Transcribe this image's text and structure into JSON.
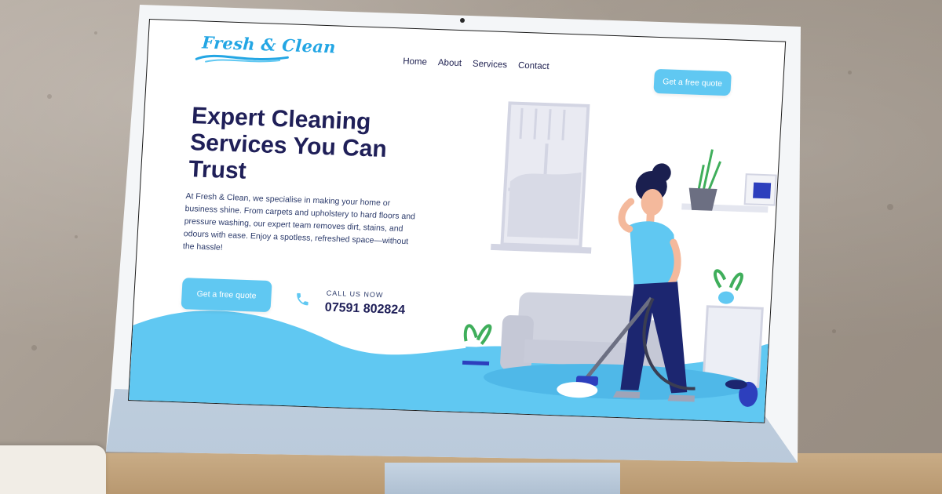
{
  "site": {
    "logo_text": "Fresh & Clean",
    "nav": [
      {
        "label": "Home"
      },
      {
        "label": "About"
      },
      {
        "label": "Services"
      },
      {
        "label": "Contact"
      }
    ],
    "cta_nav_label": "Get a free quote"
  },
  "hero": {
    "headline": "Expert Cleaning Services You Can Trust",
    "description": "At Fresh & Clean, we specialise in making your home or business shine. From carpets and upholstery to hard floors and pressure washing, our expert team removes dirt, stains, and odours with ease. Enjoy a spotless, refreshed space—without the hassle!",
    "cta_label": "Get a free quote",
    "call_label": "CALL US NOW",
    "call_number": "07591 802824"
  },
  "icons": {
    "phone": "phone-icon",
    "logo_swoosh": "wave-swoosh-icon",
    "camera": "camera-icon"
  },
  "colors": {
    "brand_blue": "#23a6e4",
    "button": "#60c8f2",
    "navy_text": "#1f1f58",
    "wave_fill": "#60c8f2"
  }
}
